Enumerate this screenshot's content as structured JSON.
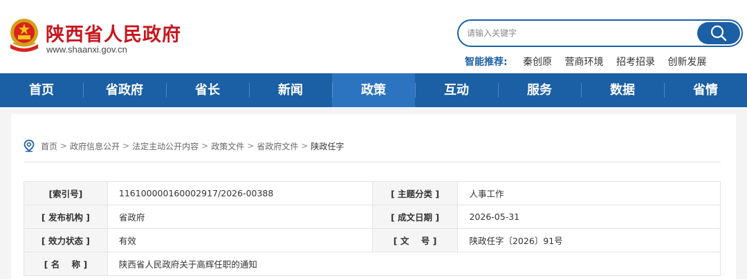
{
  "header": {
    "site_title": "陕西省人民政府",
    "site_url": "www.shaanxi.gov.cn",
    "search_placeholder": "请输入关键字",
    "recommend_label": "智能推荐:",
    "recommend_links": [
      "秦创原",
      "营商环境",
      "招考招录",
      "创新发展"
    ]
  },
  "nav": {
    "items": [
      "首页",
      "省政府",
      "省长",
      "新闻",
      "政策",
      "互动",
      "服务",
      "数据",
      "省情"
    ],
    "active": "政策"
  },
  "breadcrumb": [
    "首页",
    "政府信息公开",
    "法定主动公开内容",
    "政策文件",
    "省政府文件",
    "陕政任字"
  ],
  "breadcrumb_sep": ">",
  "meta": {
    "index_label": "[索引号]",
    "index_value": "116100000160002917/2026-00388",
    "topic_label": "[ 主题分类 ]",
    "topic_value": "人事工作",
    "issuer_label": "[ 发布机构 ]",
    "issuer_value": "省政府",
    "date_label": "[ 成文日期 ]",
    "date_value": "2026-05-31",
    "status_label": "[ 效力状态 ]",
    "status_value": "有效",
    "docno_label": "[ 文    号 ]",
    "docno_value": "陕政任字〔2026〕91号",
    "name_label": "[ 名    称 ]",
    "name_value": "陕西省人民政府关于高辉任职的通知"
  },
  "colors": {
    "brand_blue": "#1b5fa5",
    "nav_active": "#2d74c0",
    "title_red": "#c8161d"
  },
  "icons": [
    "national-emblem-icon",
    "search-icon",
    "location-pin-icon"
  ]
}
